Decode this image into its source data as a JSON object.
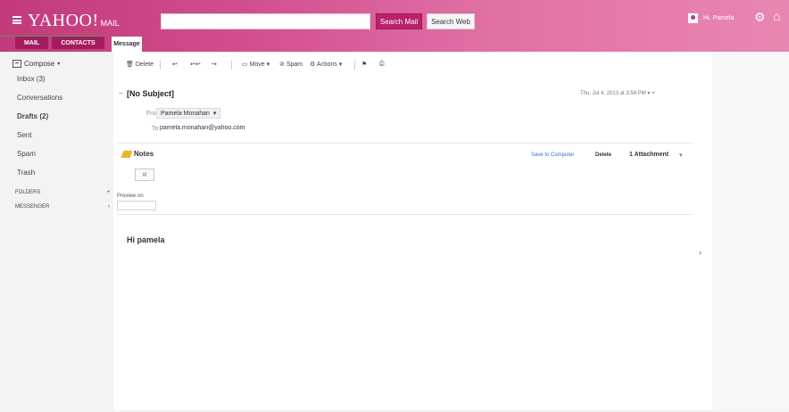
{
  "header": {
    "logo": "YAHOO!",
    "logo_suffix": "MAIL",
    "search_placeholder": "",
    "search_mail_label": "Search Mail",
    "search_web_label": "Search Web",
    "user_name": "Hi, Pamela",
    "icons": [
      "menu-icon",
      "avatar",
      "gear-icon",
      "home-icon"
    ],
    "accent_color": "#c23a7a"
  },
  "tabs": {
    "mail": "MAIL",
    "contacts": "CONTACTS",
    "message": "Message"
  },
  "sidebar": {
    "compose": "Compose",
    "folders": [
      {
        "label": "Inbox (3)",
        "bold": false
      },
      {
        "label": "Conversations",
        "bold": false
      },
      {
        "label": "Drafts (2)",
        "bold": true
      },
      {
        "label": "Sent",
        "bold": false
      },
      {
        "label": "Spam",
        "bold": false
      },
      {
        "label": "Trash",
        "bold": false
      }
    ],
    "sections": [
      {
        "label": "FOLDERS"
      },
      {
        "label": "MESSENGER"
      }
    ]
  },
  "toolbar": {
    "delete": "Delete",
    "move": "Move",
    "spam": "Spam",
    "actions": "Actions"
  },
  "message": {
    "subject": "[No Subject]",
    "date": "Thu, Jul 4, 2013 at 3:58 PM",
    "from_label": "From",
    "from_value": "Pamela Monahan",
    "to_label": "To",
    "to_value": "pamela.monahan@yahoo.com",
    "attachment_title": "Notes",
    "save_to_contacts": "Save to Computer",
    "delete_link": "Delete",
    "attachment_count": "1 Attachment",
    "preview_label": "Preview on",
    "greeting": "Hi pamela"
  }
}
